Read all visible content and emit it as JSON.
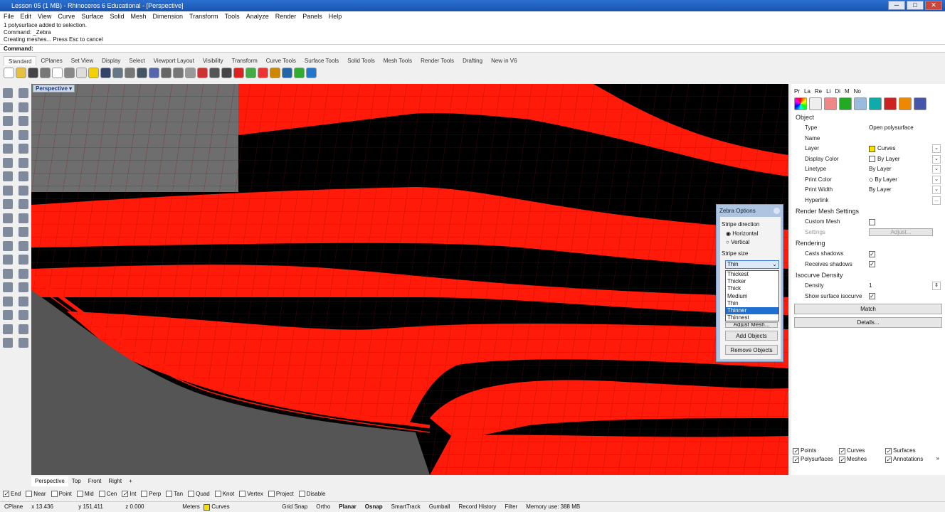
{
  "window": {
    "title": "Lesson 05 (1 MB) - Rhinoceros 6 Educational - [Perspective]",
    "minimize": "─",
    "maximize": "□",
    "close": "✕"
  },
  "menu": [
    "File",
    "Edit",
    "View",
    "Curve",
    "Surface",
    "Solid",
    "Mesh",
    "Dimension",
    "Transform",
    "Tools",
    "Analyze",
    "Render",
    "Panels",
    "Help"
  ],
  "command_history": [
    "1 polysurface added to selection.",
    "Command: _Zebra",
    "Creating meshes... Press Esc to cancel"
  ],
  "command_prompt": "Command:",
  "toolbar_tabs": [
    "Standard",
    "CPlanes",
    "Set View",
    "Display",
    "Select",
    "Viewport Layout",
    "Visibility",
    "Transform",
    "Curve Tools",
    "Surface Tools",
    "Solid Tools",
    "Mesh Tools",
    "Render Tools",
    "Drafting",
    "New in V6"
  ],
  "viewport": {
    "label": "Perspective",
    "menu_arrow": "▾"
  },
  "panel": {
    "tabs": [
      "Pr",
      "La",
      "Re",
      "Li",
      "Di",
      "M",
      "No"
    ],
    "object_heading": "Object",
    "properties": [
      {
        "key": "Type",
        "value": "Open polysurface"
      },
      {
        "key": "Name",
        "value": ""
      },
      {
        "key": "Layer",
        "value": "Curves",
        "swatch": "#f5e000",
        "dropdown": true
      },
      {
        "key": "Display Color",
        "value": "By Layer",
        "swatch": "#ffffff",
        "dropdown": true
      },
      {
        "key": "Linetype",
        "value": "By Layer",
        "dropdown": true
      },
      {
        "key": "Print Color",
        "value": "◇ By Layer",
        "dropdown": true
      },
      {
        "key": "Print Width",
        "value": "By Layer",
        "dropdown": true
      },
      {
        "key": "Hyperlink",
        "value": "",
        "button": "..."
      }
    ],
    "render_mesh_heading": "Render Mesh Settings",
    "custom_mesh_label": "Custom Mesh",
    "custom_mesh": false,
    "settings_label": "Settings",
    "adjust_button": "Adjust...",
    "rendering_heading": "Rendering",
    "casts_shadows_label": "Casts shadows",
    "casts_shadows": true,
    "receives_shadows_label": "Receives shadows",
    "receives_shadows": true,
    "isocurve_heading": "Isocurve Density",
    "density_label": "Density",
    "density_value": "1",
    "show_isocurve_label": "Show surface isocurve",
    "show_isocurve": true,
    "match_button": "Match",
    "details_button": "Details..."
  },
  "zebra": {
    "title": "Zebra Options",
    "stripe_direction_label": "Stripe direction",
    "horizontal": "Horizontal",
    "vertical": "Vertical",
    "direction": "Horizontal",
    "stripe_size_label": "Stripe size",
    "stripe_size": "Thin",
    "options": [
      "Thickest",
      "Thicker",
      "Thick",
      "Medium",
      "Thin",
      "Thinner",
      "Thinnest"
    ],
    "highlighted": "Thinner",
    "adjust_mesh": "Adjust Mesh...",
    "add_objects": "Add Objects",
    "remove_objects": "Remove Objects"
  },
  "filters": [
    {
      "label": "Points",
      "checked": true
    },
    {
      "label": "Curves",
      "checked": true
    },
    {
      "label": "Surfaces",
      "checked": true
    },
    {
      "label": "Polysurfaces",
      "checked": true
    },
    {
      "label": "Meshes",
      "checked": true
    },
    {
      "label": "Annotations",
      "checked": true
    }
  ],
  "filters_more": "»",
  "viewport_tabs": [
    "Perspective",
    "Top",
    "Front",
    "Right"
  ],
  "viewport_tab_add": "+",
  "osnaps": [
    {
      "label": "End",
      "checked": true
    },
    {
      "label": "Near",
      "checked": false
    },
    {
      "label": "Point",
      "checked": false
    },
    {
      "label": "Mid",
      "checked": false
    },
    {
      "label": "Cen",
      "checked": false
    },
    {
      "label": "Int",
      "checked": true
    },
    {
      "label": "Perp",
      "checked": false
    },
    {
      "label": "Tan",
      "checked": false
    },
    {
      "label": "Quad",
      "checked": false
    },
    {
      "label": "Knot",
      "checked": false
    },
    {
      "label": "Vertex",
      "checked": false
    },
    {
      "label": "Project",
      "checked": false
    },
    {
      "label": "Disable",
      "checked": false
    }
  ],
  "status": {
    "cplane": "CPlane",
    "x": "x 13.436",
    "y": "y 151.411",
    "z": "z 0.000",
    "units": "Meters",
    "layer": "Curves",
    "layer_color": "#f5e000",
    "toggles": [
      {
        "label": "Grid Snap",
        "on": false
      },
      {
        "label": "Ortho",
        "on": false
      },
      {
        "label": "Planar",
        "on": true
      },
      {
        "label": "Osnap",
        "on": true
      },
      {
        "label": "SmartTrack",
        "on": false
      },
      {
        "label": "Gumball",
        "on": false
      },
      {
        "label": "Record History",
        "on": false
      },
      {
        "label": "Filter",
        "on": false
      }
    ],
    "memory": "Memory use: 388 MB"
  },
  "colors": {
    "zebra_red": "#ff1a0a",
    "zebra_black": "#000000",
    "title_blue": "#1a55b0",
    "selection": "#1e6fd0"
  }
}
